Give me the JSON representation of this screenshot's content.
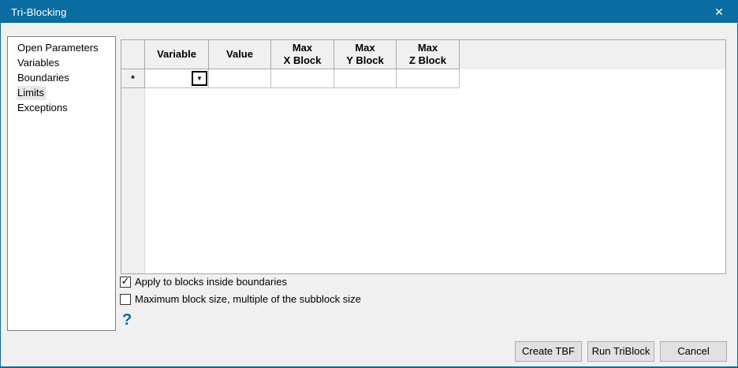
{
  "window": {
    "title": "Tri-Blocking",
    "close_glyph": "✕"
  },
  "colors": {
    "titlebar": "#0a6ca0",
    "accent": "#0a6ca0",
    "panel_background": "#f0f0f0",
    "grid_background": "#ffffff",
    "button_background": "#e1e1e1"
  },
  "sidebar": {
    "items": [
      {
        "label": "Open Parameters",
        "selected": false
      },
      {
        "label": "Variables",
        "selected": false
      },
      {
        "label": "Boundaries",
        "selected": false
      },
      {
        "label": "Limits",
        "selected": true
      },
      {
        "label": "Exceptions",
        "selected": false
      }
    ]
  },
  "grid": {
    "columns": [
      {
        "line1": "Variable",
        "line2": ""
      },
      {
        "line1": "Value",
        "line2": ""
      },
      {
        "line1": "Max",
        "line2": "X Block"
      },
      {
        "line1": "Max",
        "line2": "Y Block"
      },
      {
        "line1": "Max",
        "line2": "Z Block"
      }
    ],
    "new_row_marker": "*",
    "dropdown_glyph": "▼",
    "rows": [
      {
        "variable": "",
        "value": "",
        "max_x_block": "",
        "max_y_block": "",
        "max_z_block": ""
      }
    ]
  },
  "options": {
    "apply_inside_boundaries": {
      "label": "Apply to blocks inside boundaries",
      "checked": true,
      "check_glyph": "✓"
    },
    "max_block_multiple": {
      "label": "Maximum block size, multiple of the subblock size",
      "checked": false,
      "check_glyph": ""
    }
  },
  "help": {
    "glyph": "?"
  },
  "footer": {
    "create_tbf_label": "Create TBF",
    "run_triblock_label": "Run TriBlock",
    "cancel_label": "Cancel"
  }
}
